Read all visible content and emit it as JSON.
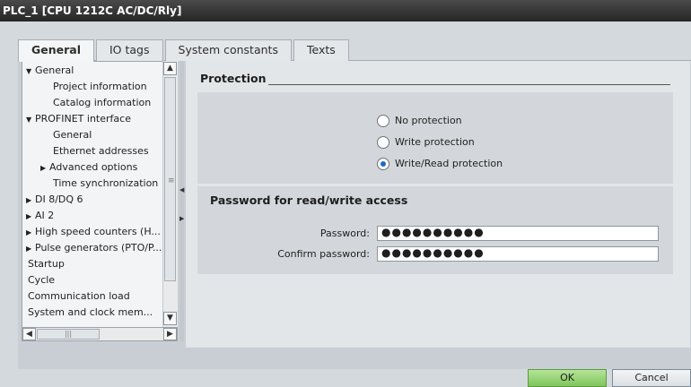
{
  "window": {
    "title": "PLC_1 [CPU 1212C AC/DC/Rly]"
  },
  "tabs": [
    {
      "label": "General",
      "active": true
    },
    {
      "label": "IO tags",
      "active": false
    },
    {
      "label": "System constants",
      "active": false
    },
    {
      "label": "Texts",
      "active": false
    }
  ],
  "tree": {
    "items": [
      {
        "label": "General",
        "arrow": "▼"
      },
      {
        "label": "Project information",
        "arrow": ""
      },
      {
        "label": "Catalog information",
        "arrow": ""
      },
      {
        "label": "PROFINET interface",
        "arrow": "▼"
      },
      {
        "label": "General",
        "arrow": ""
      },
      {
        "label": "Ethernet addresses",
        "arrow": ""
      },
      {
        "label": "Advanced options",
        "arrow": "▶"
      },
      {
        "label": "Time synchronization",
        "arrow": ""
      },
      {
        "label": "DI 8/DQ 6",
        "arrow": "▶"
      },
      {
        "label": "AI 2",
        "arrow": "▶"
      },
      {
        "label": "High speed counters (H...",
        "arrow": "▶"
      },
      {
        "label": "Pulse generators (PTO/P...",
        "arrow": "▶"
      },
      {
        "label": "Startup",
        "arrow": ""
      },
      {
        "label": "Cycle",
        "arrow": ""
      },
      {
        "label": "Communication load",
        "arrow": ""
      },
      {
        "label": "System and clock mem...",
        "arrow": ""
      }
    ]
  },
  "protection": {
    "title": "Protection",
    "options": [
      {
        "label": "No protection",
        "selected": false
      },
      {
        "label": "Write protection",
        "selected": false
      },
      {
        "label": "Write/Read protection",
        "selected": true
      }
    ]
  },
  "password": {
    "title": "Password for read/write access",
    "password_label": "Password:",
    "password_value": "●●●●●●●●●●",
    "confirm_label": "Confirm password:",
    "confirm_value": "●●●●●●●●●●"
  },
  "buttons": {
    "ok": "OK",
    "cancel": "Cancel"
  }
}
